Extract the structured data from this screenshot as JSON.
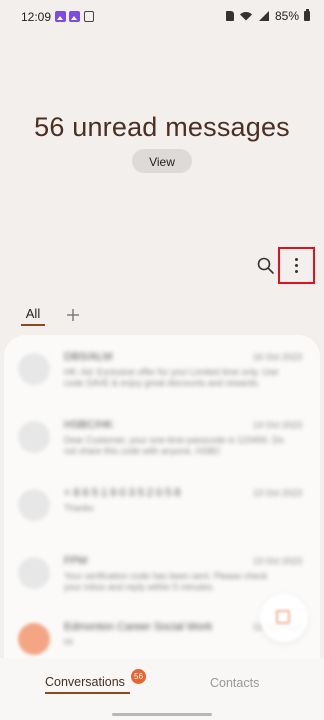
{
  "status_bar": {
    "time": "12:09",
    "notification_icons": [
      "gallery-icon",
      "gallery-icon",
      "document-icon"
    ],
    "battery": "85%"
  },
  "hero": {
    "title": "56 unread messages",
    "view_label": "View"
  },
  "toolbar": {
    "highlight_color": "#e0101c"
  },
  "tabs": {
    "all_label": "All"
  },
  "conversations": [
    {
      "avatar": "person-icon",
      "name": "DBS/ALM",
      "date": "16 Oct 2023",
      "preview": "HK: Ad: Exclusive offer for you! Limited time only. Use code SAVE & enjoy great discounts and rewards."
    },
    {
      "avatar": "person-icon",
      "name": "HSBC/HK",
      "date": "14 Oct 2023",
      "preview": "Dear Customer, your one-time passcode is 123456. Do not share this code with anyone. HSBC"
    },
    {
      "avatar": "person-icon",
      "name": "+ 8 6 5 1 9 0 3 5 2 0 5 8",
      "date": "13 Oct 2023",
      "preview": "Thanks"
    },
    {
      "avatar": "person-icon",
      "name": "FPM",
      "date": "13 Oct 2023",
      "preview": "Your verification code has been sent. Please check your inbox and reply within 5 minutes."
    },
    {
      "avatar": "person-icon-orange",
      "name": "Edmonton Career Social Work",
      "date": "13 Oct 2023",
      "preview": "Hi"
    }
  ],
  "bottom_nav": {
    "conversations_label": "Conversations",
    "badge_count": "56",
    "contacts_label": "Contacts"
  },
  "colors": {
    "accent": "#8b4a1f",
    "badge": "#e86530",
    "background": "#f3efed"
  }
}
